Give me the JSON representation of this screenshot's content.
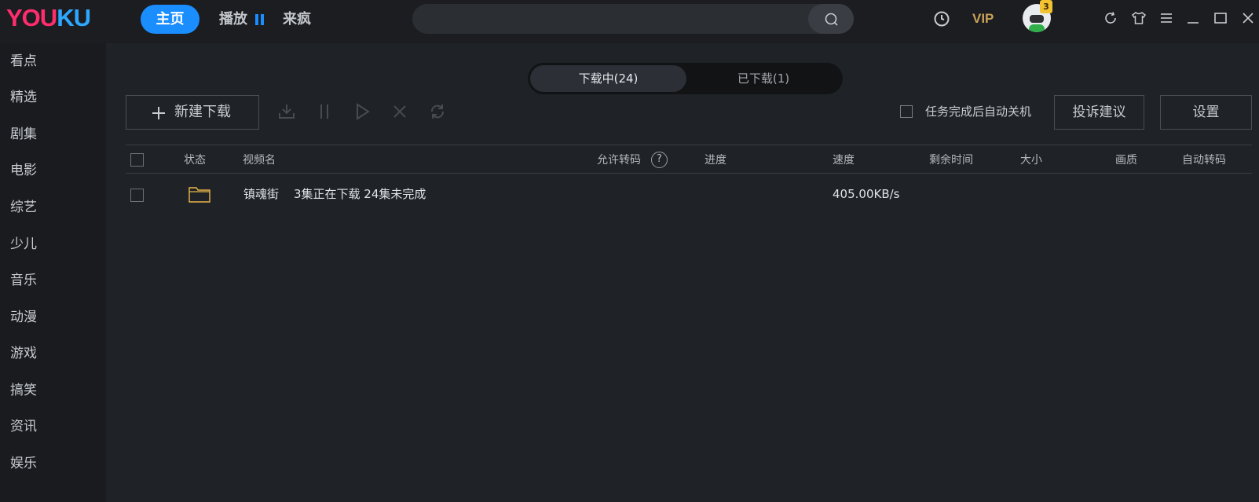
{
  "app": {
    "logo_part1": "YOU",
    "logo_part2": "KU"
  },
  "nav": {
    "home": "主页",
    "play": "播放",
    "lai_feng": "来疯"
  },
  "search": {
    "placeholder": ""
  },
  "header": {
    "vip": "VIP",
    "user_badge": "3"
  },
  "sidebar": {
    "items": [
      {
        "label": "看点"
      },
      {
        "label": "精选"
      },
      {
        "label": "剧集"
      },
      {
        "label": "电影"
      },
      {
        "label": "综艺"
      },
      {
        "label": "少儿"
      },
      {
        "label": "音乐"
      },
      {
        "label": "动漫"
      },
      {
        "label": "游戏"
      },
      {
        "label": "搞笑"
      },
      {
        "label": "资讯"
      },
      {
        "label": "娱乐"
      }
    ]
  },
  "tabs": {
    "downloading": "下载中(24)",
    "downloaded": "已下载(1)"
  },
  "toolbar": {
    "new_download": "新建下载",
    "auto_shutdown": "任务完成后自动关机",
    "complain": "投诉建议",
    "settings": "设置"
  },
  "table": {
    "headers": {
      "status": "状态",
      "name": "视频名",
      "allow_transcode": "允许转码",
      "help": "?",
      "progress": "进度",
      "speed": "速度",
      "remaining": "剩余时间",
      "size": "大小",
      "quality": "画质",
      "auto_transcode": "自动转码"
    },
    "rows": [
      {
        "name": "镇魂街",
        "status_text": "3集正在下载 24集未完成",
        "speed": "405.00KB/s",
        "status_icon": "folder-icon"
      }
    ]
  },
  "colors": {
    "accent": "#1a8dff",
    "logo_pink": "#ff2d6e",
    "logo_blue": "#2ea7ff",
    "vip_gold": "#c8a15a",
    "folder_yellow": "#e8b64a"
  }
}
